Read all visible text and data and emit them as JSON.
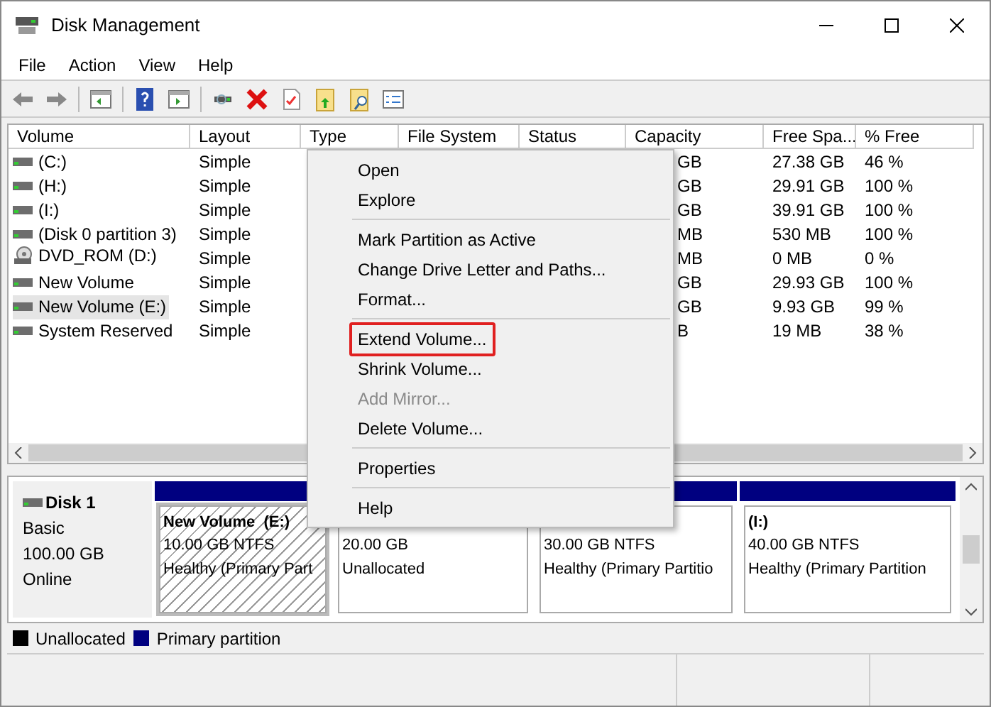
{
  "window": {
    "title": "Disk Management"
  },
  "menu": [
    "File",
    "Action",
    "View",
    "Help"
  ],
  "table": {
    "columns": [
      "Volume",
      "Layout",
      "Type",
      "File System",
      "Status",
      "Capacity",
      "Free Spa...",
      "% Free"
    ],
    "rows": [
      {
        "kind": "drive",
        "volume": "(C:)",
        "layout": "Simple",
        "capacity": "GB",
        "free": "27.38 GB",
        "pct": "46 %",
        "selected": false
      },
      {
        "kind": "drive",
        "volume": "(H:)",
        "layout": "Simple",
        "capacity": "GB",
        "free": "29.91 GB",
        "pct": "100 %",
        "selected": false
      },
      {
        "kind": "drive",
        "volume": "(I:)",
        "layout": "Simple",
        "capacity": "GB",
        "free": "39.91 GB",
        "pct": "100 %",
        "selected": false
      },
      {
        "kind": "drive",
        "volume": "(Disk 0 partition 3)",
        "layout": "Simple",
        "capacity": "MB",
        "free": "530 MB",
        "pct": "100 %",
        "selected": false
      },
      {
        "kind": "dvd",
        "volume": "DVD_ROM (D:)",
        "layout": "Simple",
        "capacity": "MB",
        "free": "0 MB",
        "pct": "0 %",
        "selected": false
      },
      {
        "kind": "drive",
        "volume": "New Volume",
        "layout": "Simple",
        "capacity": "GB",
        "free": "29.93 GB",
        "pct": "100 %",
        "selected": false
      },
      {
        "kind": "drive",
        "volume": "New Volume (E:)",
        "layout": "Simple",
        "capacity": "GB",
        "free": "9.93 GB",
        "pct": "99 %",
        "selected": true
      },
      {
        "kind": "drive",
        "volume": "System Reserved",
        "layout": "Simple",
        "capacity": "B",
        "free": "19 MB",
        "pct": "38 %",
        "selected": false
      }
    ]
  },
  "context_menu": [
    {
      "kind": "item",
      "label": "Open",
      "disabled": false,
      "highlighted": false
    },
    {
      "kind": "item",
      "label": "Explore",
      "disabled": false,
      "highlighted": false
    },
    {
      "kind": "separator"
    },
    {
      "kind": "item",
      "label": "Mark Partition as Active",
      "disabled": false,
      "highlighted": false
    },
    {
      "kind": "item",
      "label": "Change Drive Letter and Paths...",
      "disabled": false,
      "highlighted": false
    },
    {
      "kind": "item",
      "label": "Format...",
      "disabled": false,
      "highlighted": false
    },
    {
      "kind": "separator"
    },
    {
      "kind": "item",
      "label": "Extend Volume...",
      "disabled": false,
      "highlighted": true
    },
    {
      "kind": "item",
      "label": "Shrink Volume...",
      "disabled": false,
      "highlighted": false
    },
    {
      "kind": "item",
      "label": "Add Mirror...",
      "disabled": true,
      "highlighted": false
    },
    {
      "kind": "item",
      "label": "Delete Volume...",
      "disabled": false,
      "highlighted": false
    },
    {
      "kind": "separator"
    },
    {
      "kind": "item",
      "label": "Properties",
      "disabled": false,
      "highlighted": false
    },
    {
      "kind": "separator"
    },
    {
      "kind": "item",
      "label": "Help",
      "disabled": false,
      "highlighted": false
    }
  ],
  "disk": {
    "name": "Disk 1",
    "type": "Basic",
    "size": "100.00 GB",
    "status": "Online",
    "partitions": [
      {
        "kind": "primary",
        "name": "New Volume  (E:)",
        "size": "10.00 GB NTFS",
        "status": "Healthy (Primary Part",
        "selected": true
      },
      {
        "kind": "unallocated",
        "size": "20.00 GB",
        "status": "Unallocated",
        "selected": false
      },
      {
        "kind": "primary",
        "size": "30.00 GB NTFS",
        "status": "Healthy (Primary Partitio",
        "selected": false
      },
      {
        "kind": "primary",
        "name": "(I:)",
        "size": "40.00 GB NTFS",
        "status": "Healthy (Primary Partition",
        "selected": false
      }
    ]
  },
  "legend": [
    {
      "label": "Unallocated",
      "color": "#000000"
    },
    {
      "label": "Primary partition",
      "color": "#000080"
    }
  ]
}
